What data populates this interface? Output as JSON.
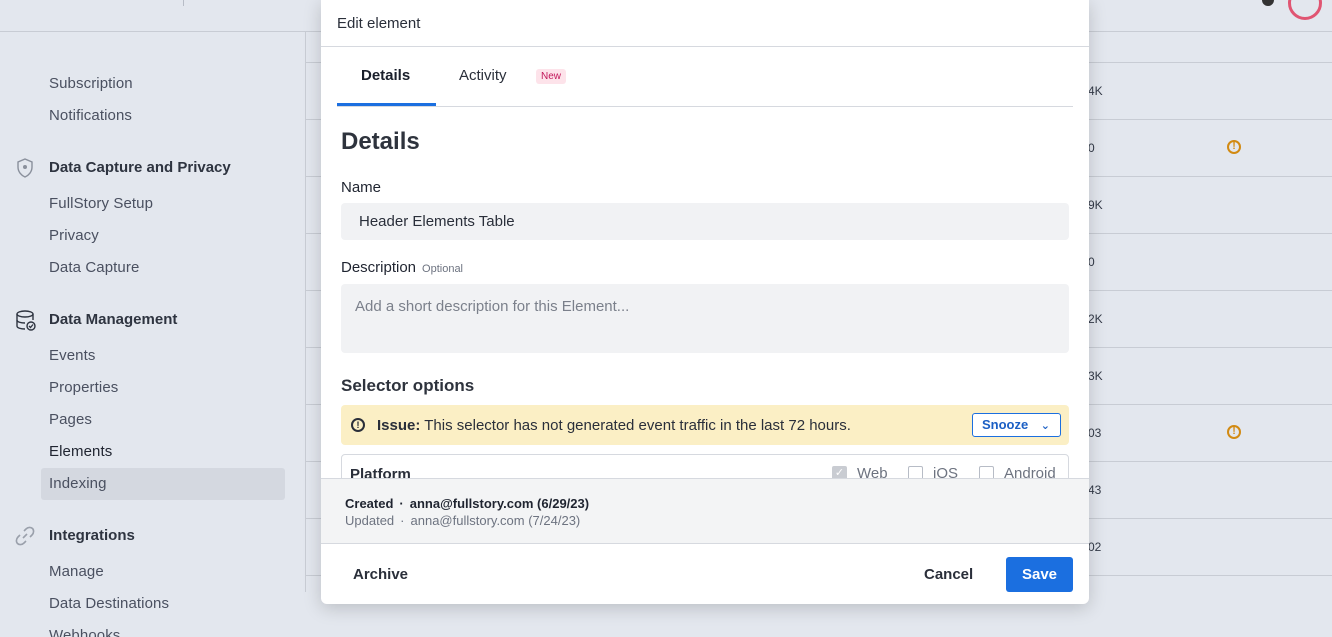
{
  "sidebar": {
    "account_items": [
      "Subscription",
      "Notifications"
    ],
    "sections": [
      {
        "title": "Data Capture and Privacy",
        "icon": "shield-icon",
        "items": [
          "FullStory Setup",
          "Privacy",
          "Data Capture"
        ]
      },
      {
        "title": "Data Management",
        "icon": "database-icon",
        "items": [
          "Events",
          "Properties",
          "Pages",
          "Elements",
          "Indexing"
        ]
      },
      {
        "title": "Integrations",
        "icon": "link-icon",
        "items": [
          "Manage",
          "Data Destinations",
          "Webhooks"
        ]
      }
    ]
  },
  "table": {
    "values": [
      "4K",
      "0",
      "9K",
      "0",
      "2K",
      "3K",
      "03",
      "43",
      "02"
    ],
    "warning_rows": [
      1,
      6
    ]
  },
  "modal": {
    "title": "Edit element",
    "tabs": {
      "details": "Details",
      "activity": "Activity",
      "activity_badge": "New"
    },
    "heading": "Details",
    "name_label": "Name",
    "name_value": "Header Elements Table",
    "description_label": "Description",
    "description_optional": "Optional",
    "description_placeholder": "Add a short description for this Element...",
    "selector_heading": "Selector options",
    "issue_label": "Issue:",
    "issue_text": "This selector has not generated event traffic in the last 72 hours.",
    "snooze_label": "Snooze",
    "platform_label": "Platform",
    "platforms": [
      {
        "label": "Web",
        "checked": true
      },
      {
        "label": "iOS",
        "checked": false
      },
      {
        "label": "Android",
        "checked": false
      }
    ],
    "created_label": "Created",
    "created_value": "anna@fullstory.com (6/29/23)",
    "updated_label": "Updated",
    "updated_value": "anna@fullstory.com (7/24/23)",
    "separator": "·",
    "archive_label": "Archive",
    "cancel_label": "Cancel",
    "save_label": "Save"
  },
  "colors": {
    "primary": "#1b6fe0",
    "warning_bg": "#fbefc5",
    "badge_bg": "#fde3ea",
    "badge_text": "#c2185b"
  }
}
